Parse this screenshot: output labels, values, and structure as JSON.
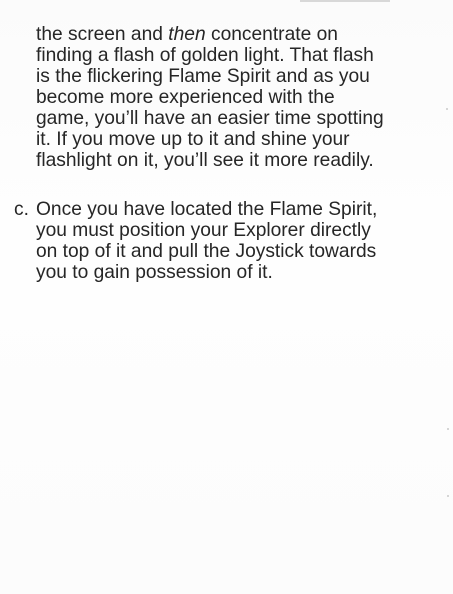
{
  "paragraph_continued": {
    "lines": [
      {
        "before": "the screen and ",
        "emphasis": "then",
        "after": " concentrate on"
      },
      {
        "text": "finding a flash of golden light. That flash"
      },
      {
        "text": "is the flickering Flame Spirit and as you"
      },
      {
        "text": "become more experienced with the"
      },
      {
        "text": "game, you’ll have an easier time spotting"
      },
      {
        "text": "it. If you move up to it and shine your"
      },
      {
        "text": "flashlight on it, you’ll see it more readily."
      }
    ]
  },
  "item_c": {
    "marker": "c.",
    "lines": [
      "Once you have located the Flame Spirit,",
      "you must position your Explorer directly",
      "on top of it and pull the Joystick towards",
      "you to gain possession of it."
    ]
  }
}
